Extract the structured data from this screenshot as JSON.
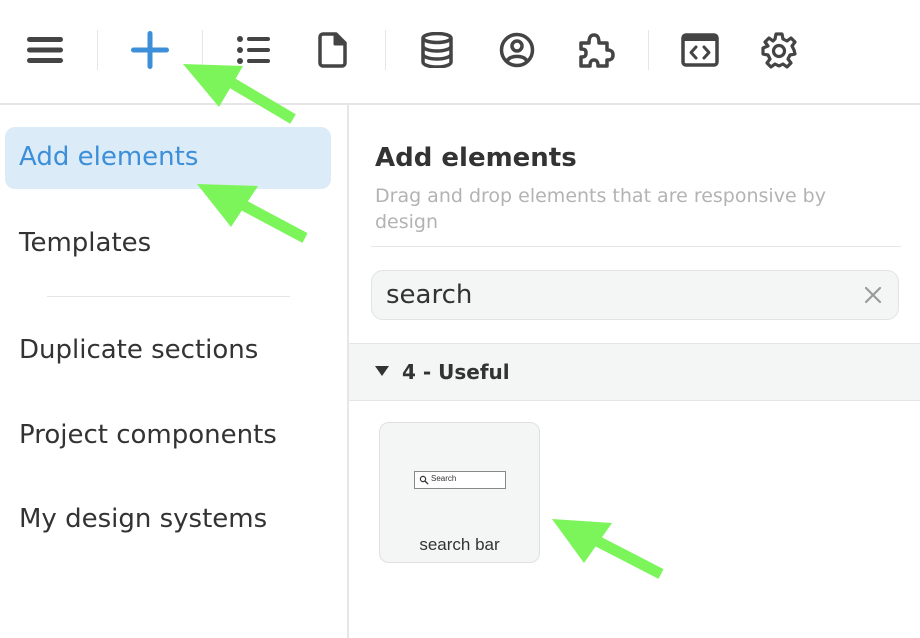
{
  "colors": {
    "accent": "#3c8fd8",
    "active_bg": "#dcebf8",
    "icon": "#444444",
    "annotation_arrow": "#7cf55a"
  },
  "toolbar": {
    "items": [
      {
        "icon": "menu-icon"
      },
      {
        "icon": "plus-icon",
        "active": true
      },
      {
        "icon": "list-icon"
      },
      {
        "icon": "page-icon"
      },
      {
        "icon": "database-icon"
      },
      {
        "icon": "user-circle-icon"
      },
      {
        "icon": "puzzle-icon"
      },
      {
        "icon": "code-icon"
      },
      {
        "icon": "gear-icon"
      }
    ]
  },
  "sidebar": {
    "items": [
      {
        "label": "Add elements",
        "active": true
      },
      {
        "label": "Templates"
      },
      {
        "label": "Duplicate sections"
      },
      {
        "label": "Project components"
      },
      {
        "label": "My design systems"
      }
    ]
  },
  "main": {
    "title": "Add elements",
    "subtitle": "Drag and drop elements that are responsive by design",
    "search": {
      "value": "search"
    },
    "section": {
      "label": "4 - Useful",
      "expanded": true
    },
    "elements": [
      {
        "label": "search bar",
        "preview_text": "Search"
      }
    ]
  }
}
